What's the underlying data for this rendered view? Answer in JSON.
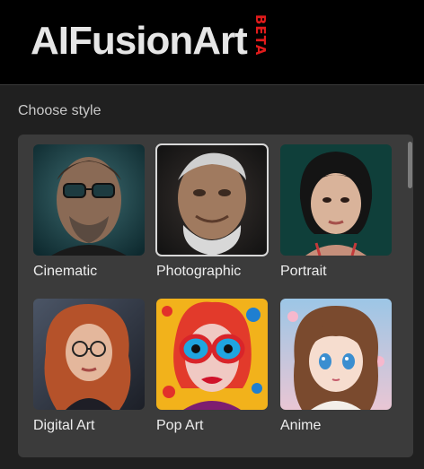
{
  "header": {
    "logo_text": "AIFusionArt",
    "badge": "BETA"
  },
  "choose_style": {
    "label": "Choose style"
  },
  "styles": [
    {
      "label": "Cinematic",
      "selected": false,
      "icon": "cinematic-portrait-thumbnail"
    },
    {
      "label": "Photographic",
      "selected": true,
      "icon": "photographic-portrait-thumbnail"
    },
    {
      "label": "Portrait",
      "selected": false,
      "icon": "portrait-thumbnail"
    },
    {
      "label": "Digital Art",
      "selected": false,
      "icon": "digital-art-thumbnail"
    },
    {
      "label": "Pop Art",
      "selected": false,
      "icon": "pop-art-thumbnail"
    },
    {
      "label": "Anime",
      "selected": false,
      "icon": "anime-thumbnail"
    }
  ],
  "colors": {
    "header_bg": "#000000",
    "page_bg": "#202020",
    "panel_bg": "#3b3b3b",
    "beta_red": "#e01b1b"
  }
}
